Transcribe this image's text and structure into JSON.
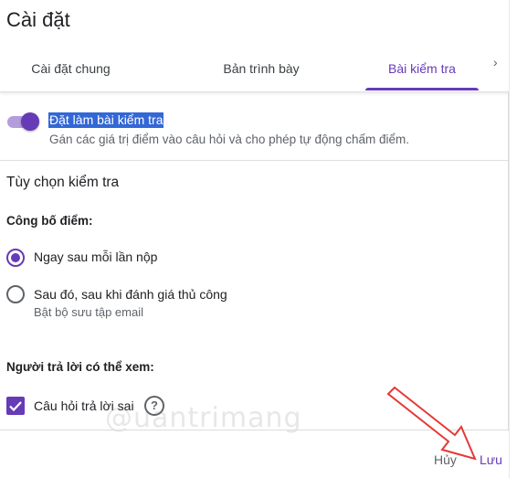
{
  "dialog": {
    "title": "Cài đặt"
  },
  "tabs": [
    {
      "label": "Cài đặt chung"
    },
    {
      "label": "Bản trình bày"
    },
    {
      "label": "Bài kiểm tra"
    }
  ],
  "quiz_toggle": {
    "label": "Đặt làm bài kiểm tra",
    "description": "Gán các giá trị điểm vào câu hỏi và cho phép tự động chấm điểm.",
    "enabled": true
  },
  "quiz_options": {
    "section_title": "Tùy chọn kiểm tra",
    "release_grade": {
      "heading": "Công bố điểm:",
      "options": [
        {
          "label": "Ngay sau mỗi lần nộp",
          "selected": true
        },
        {
          "label": "Sau đó, sau khi đánh giá thủ công",
          "sublabel": "Bật bộ sưu tập email",
          "selected": false
        }
      ]
    },
    "respondent_can_see": {
      "heading": "Người trả lời có thể xem:",
      "items": [
        {
          "label": "Câu hỏi trả lời sai",
          "checked": true
        }
      ]
    }
  },
  "footer": {
    "cancel_label": "Hủy",
    "save_label": "Lưu"
  },
  "watermark": "@uantrimang",
  "colors": {
    "accent": "#673ab7",
    "highlight": "#3367d6",
    "arrow": "#e53935"
  }
}
